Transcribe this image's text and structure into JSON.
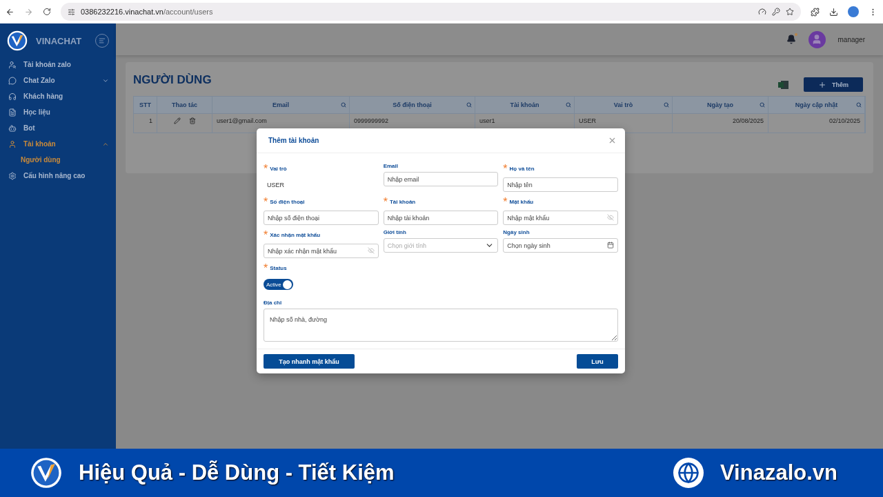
{
  "browser": {
    "url_host": "0386232216.vinachat.vn",
    "url_path": "/account/users"
  },
  "sidebar": {
    "brand": "VINACHAT",
    "items": [
      {
        "label": "Tài khoản zalo",
        "selected": false
      },
      {
        "label": "Chat Zalo",
        "selected": false,
        "expanded": false
      },
      {
        "label": "Khách hàng",
        "selected": false
      },
      {
        "label": "Học liệu",
        "selected": false
      },
      {
        "label": "Bot",
        "selected": false
      },
      {
        "label": "Tài khoản",
        "selected": true,
        "expanded": true,
        "children": [
          {
            "label": "Người dùng",
            "selected": true
          }
        ]
      },
      {
        "label": "Cấu hình nâng cao",
        "selected": false
      }
    ]
  },
  "header": {
    "user": "manager",
    "notification": true
  },
  "page": {
    "title": "NGƯỜI DÙNG",
    "add_button": "Thêm"
  },
  "table": {
    "columns": [
      {
        "label": "STT",
        "searchable": false
      },
      {
        "label": "Thao tác",
        "searchable": false
      },
      {
        "label": "Email",
        "searchable": true
      },
      {
        "label": "Số điện thoại",
        "searchable": true
      },
      {
        "label": "Tài khoản",
        "searchable": true
      },
      {
        "label": "Vai trò",
        "searchable": true
      },
      {
        "label": "Ngày tạo",
        "searchable": true
      },
      {
        "label": "Ngày cập nhật",
        "searchable": true
      }
    ],
    "rows": [
      [
        "1",
        "",
        "user1@gmail.com",
        "0999999992",
        "user1",
        "USER",
        "20/08/2025",
        "02/10/2025"
      ]
    ]
  },
  "modal": {
    "title": "Thêm tài khoản",
    "required_mark": "*",
    "fields": [
      {
        "kind": "static",
        "label": "Vai trò",
        "required": true,
        "value": "USER"
      },
      {
        "kind": "text",
        "label": "Email",
        "required": false,
        "placeholder": "Nhập email"
      },
      {
        "kind": "text",
        "label": "Họ và tên",
        "required": true,
        "placeholder": "Nhập tên"
      },
      {
        "kind": "text",
        "label": "Số điện thoại",
        "required": true,
        "placeholder": "Nhập số điện thoại"
      },
      {
        "kind": "text",
        "label": "Tài khoản",
        "required": true,
        "placeholder": "Nhập tài khoản"
      },
      {
        "kind": "password",
        "label": "Mật khẩu",
        "required": true,
        "placeholder": "Nhập mật khẩu"
      },
      {
        "kind": "password",
        "label": "Xác nhận mật khẩu",
        "required": true,
        "placeholder": "Nhập xác nhận mật khẩu"
      },
      {
        "kind": "select",
        "label": "Giới tính",
        "required": false,
        "placeholder": "Chọn giới tính"
      },
      {
        "kind": "date",
        "label": "Ngày sinh",
        "required": false,
        "placeholder": "Chọn ngày sinh"
      },
      {
        "kind": "switch",
        "label": "Status",
        "required": true,
        "value": "Active",
        "on": true
      },
      {
        "kind": "textarea",
        "label": "Địa chỉ",
        "required": false,
        "placeholder": "Nhập số nhà, đường"
      }
    ],
    "buttons": [
      "Tạo nhanh mật khẩu",
      "Lưu"
    ]
  },
  "banner": {
    "slogan": "Hiệu Quả - Dễ Dùng - Tiết Kiệm",
    "site": "Vinazalo.vn"
  }
}
